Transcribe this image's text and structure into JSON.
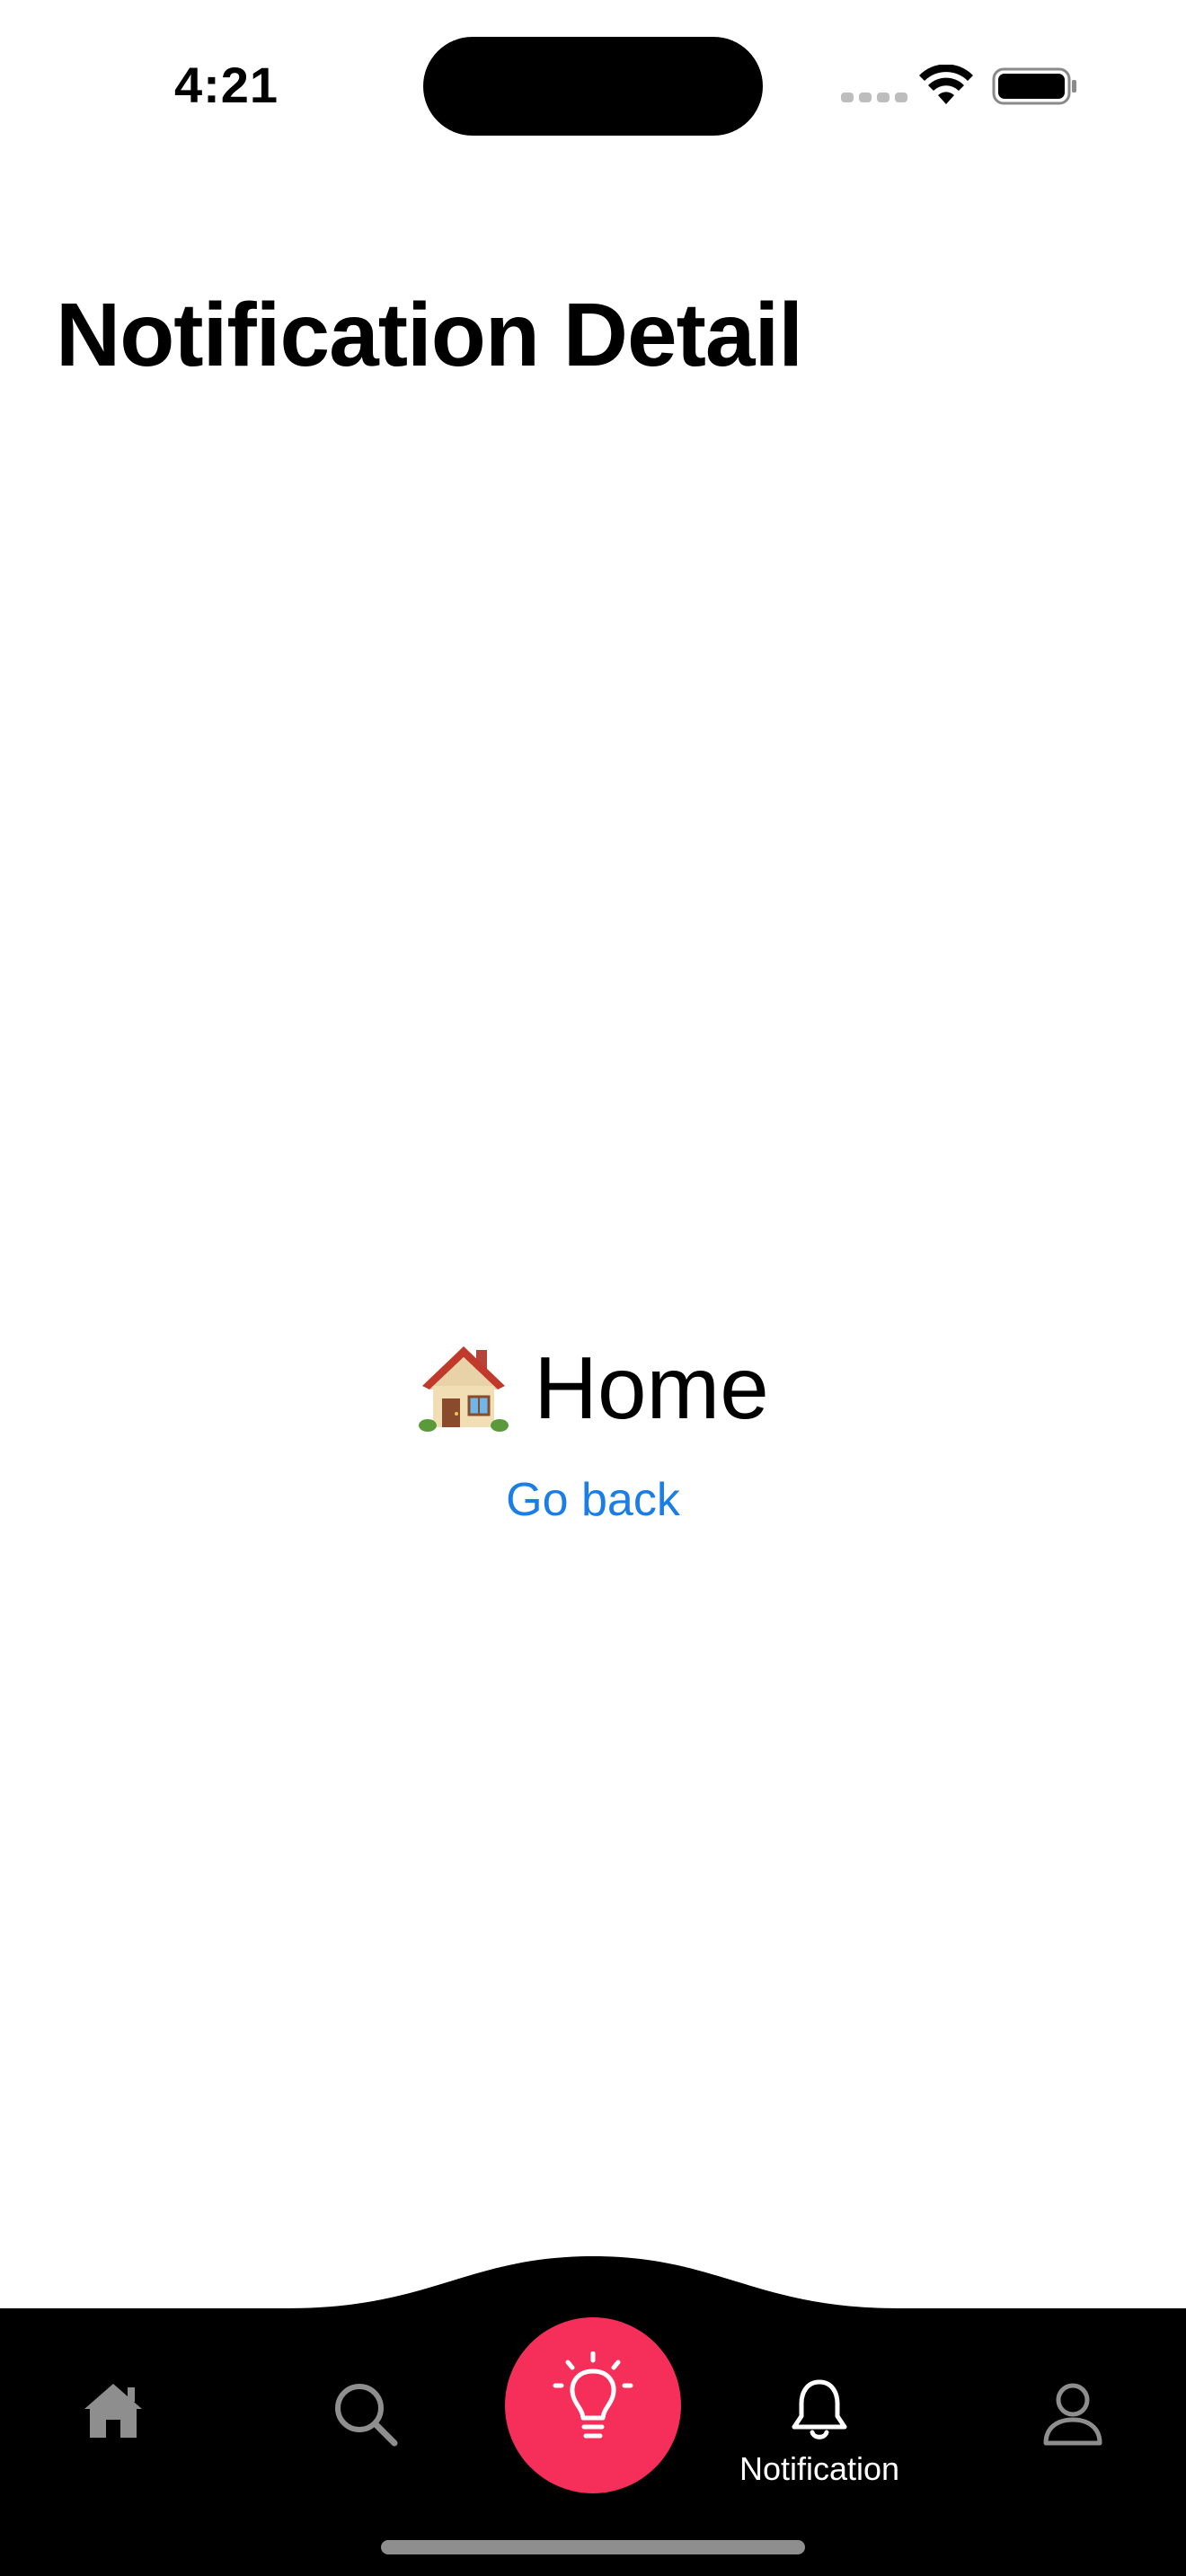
{
  "status_bar": {
    "time": "4:21"
  },
  "header": {
    "title": "Notification Detail"
  },
  "content": {
    "heading_icon": "house-emoji",
    "heading_text": "Home",
    "go_back_label": "Go back"
  },
  "tab_bar": {
    "items": [
      {
        "icon": "house-icon",
        "label": "",
        "active": false
      },
      {
        "icon": "search-icon",
        "label": "",
        "active": false
      },
      {
        "icon": "lightbulb-icon",
        "label": "",
        "active": false
      },
      {
        "icon": "bell-icon",
        "label": "Notification",
        "active": true
      },
      {
        "icon": "person-icon",
        "label": "",
        "active": false
      }
    ]
  },
  "colors": {
    "background": "#ffffff",
    "tab_bar": "#000000",
    "link": "#1a7ee6",
    "fab": "#f52e5a",
    "inactive_icon": "#8e8e8e",
    "active_icon": "#ffffff"
  }
}
